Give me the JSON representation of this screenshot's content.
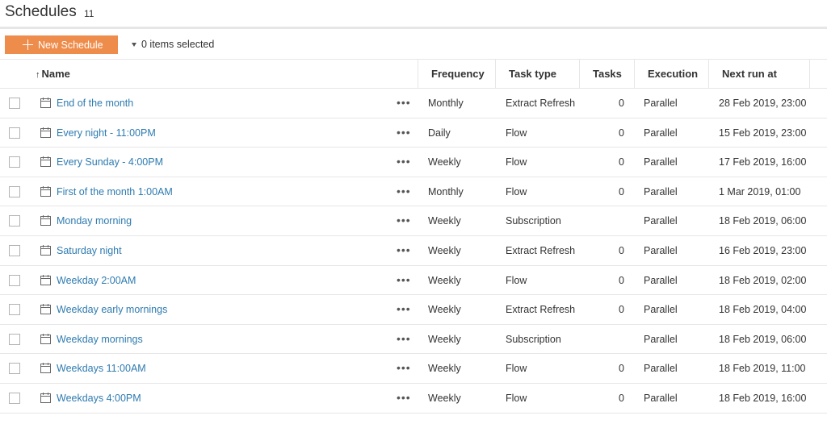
{
  "header": {
    "title": "Schedules",
    "count": "11"
  },
  "toolbar": {
    "new_label": "New Schedule",
    "selection": "0 items selected"
  },
  "columns": {
    "name": "Name",
    "frequency": "Frequency",
    "task_type": "Task type",
    "tasks": "Tasks",
    "execution": "Execution",
    "next_run": "Next run at"
  },
  "icons": {
    "sort": "sort-ascending-arrow",
    "calendar": "calendar-icon",
    "more": "more-actions-icon"
  },
  "colors": {
    "accent": "#ee8c4b",
    "link": "#2e7bb0"
  },
  "rows": [
    {
      "name": "End of the month",
      "frequency": "Monthly",
      "task_type": "Extract Refresh",
      "tasks": "0",
      "execution": "Parallel",
      "next_run": "28 Feb 2019, 23:00"
    },
    {
      "name": "Every night - 11:00PM",
      "frequency": "Daily",
      "task_type": "Flow",
      "tasks": "0",
      "execution": "Parallel",
      "next_run": "15 Feb 2019, 23:00"
    },
    {
      "name": "Every Sunday - 4:00PM",
      "frequency": "Weekly",
      "task_type": "Flow",
      "tasks": "0",
      "execution": "Parallel",
      "next_run": "17 Feb 2019, 16:00"
    },
    {
      "name": "First of the month 1:00AM",
      "frequency": "Monthly",
      "task_type": "Flow",
      "tasks": "0",
      "execution": "Parallel",
      "next_run": "1 Mar 2019, 01:00"
    },
    {
      "name": "Monday morning",
      "frequency": "Weekly",
      "task_type": "Subscription",
      "tasks": "",
      "execution": "Parallel",
      "next_run": "18 Feb 2019, 06:00"
    },
    {
      "name": "Saturday night",
      "frequency": "Weekly",
      "task_type": "Extract Refresh",
      "tasks": "0",
      "execution": "Parallel",
      "next_run": "16 Feb 2019, 23:00"
    },
    {
      "name": "Weekday 2:00AM",
      "frequency": "Weekly",
      "task_type": "Flow",
      "tasks": "0",
      "execution": "Parallel",
      "next_run": "18 Feb 2019, 02:00"
    },
    {
      "name": "Weekday early mornings",
      "frequency": "Weekly",
      "task_type": "Extract Refresh",
      "tasks": "0",
      "execution": "Parallel",
      "next_run": "18 Feb 2019, 04:00"
    },
    {
      "name": "Weekday mornings",
      "frequency": "Weekly",
      "task_type": "Subscription",
      "tasks": "",
      "execution": "Parallel",
      "next_run": "18 Feb 2019, 06:00"
    },
    {
      "name": "Weekdays 11:00AM",
      "frequency": "Weekly",
      "task_type": "Flow",
      "tasks": "0",
      "execution": "Parallel",
      "next_run": "18 Feb 2019, 11:00"
    },
    {
      "name": "Weekdays 4:00PM",
      "frequency": "Weekly",
      "task_type": "Flow",
      "tasks": "0",
      "execution": "Parallel",
      "next_run": "18 Feb 2019, 16:00"
    }
  ]
}
